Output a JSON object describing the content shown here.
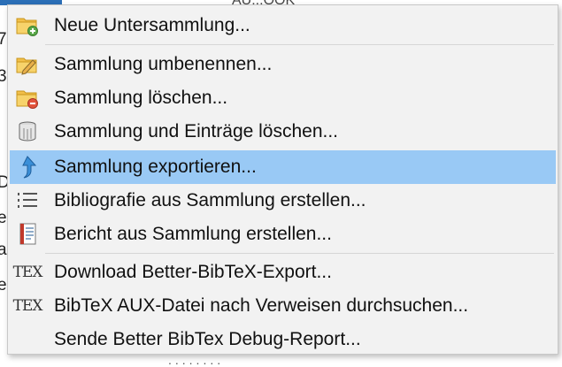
{
  "background": {
    "left_chars": [
      "7",
      "3",
      "D",
      "e",
      "a",
      "e"
    ],
    "top_fragment": "AU...OOK",
    "bottom_fragment": "........"
  },
  "menu": {
    "active_index": 4,
    "items": [
      {
        "label": "Neue Untersammlung...",
        "icon": "folder-add-icon"
      },
      {
        "label": "Sammlung umbenennen...",
        "icon": "folder-rename-icon"
      },
      {
        "label": "Sammlung löschen...",
        "icon": "folder-delete-icon"
      },
      {
        "label": "Sammlung und Einträge löschen...",
        "icon": "trash-can-icon"
      },
      {
        "label": "Sammlung exportieren...",
        "icon": "export-arrow-icon"
      },
      {
        "label": "Bibliografie aus Sammlung erstellen...",
        "icon": "bibliography-list-icon"
      },
      {
        "label": "Bericht aus Sammlung erstellen...",
        "icon": "report-document-icon"
      },
      {
        "label": "Download Better-BibTeX-Export...",
        "icon": "tex-icon",
        "icon_text": "TEX"
      },
      {
        "label": "BibTeX AUX-Datei nach Verweisen durchsuchen...",
        "icon": "tex-icon",
        "icon_text": "TEX"
      },
      {
        "label": "Sende Better BibTex Debug-Report...",
        "icon": ""
      }
    ]
  }
}
